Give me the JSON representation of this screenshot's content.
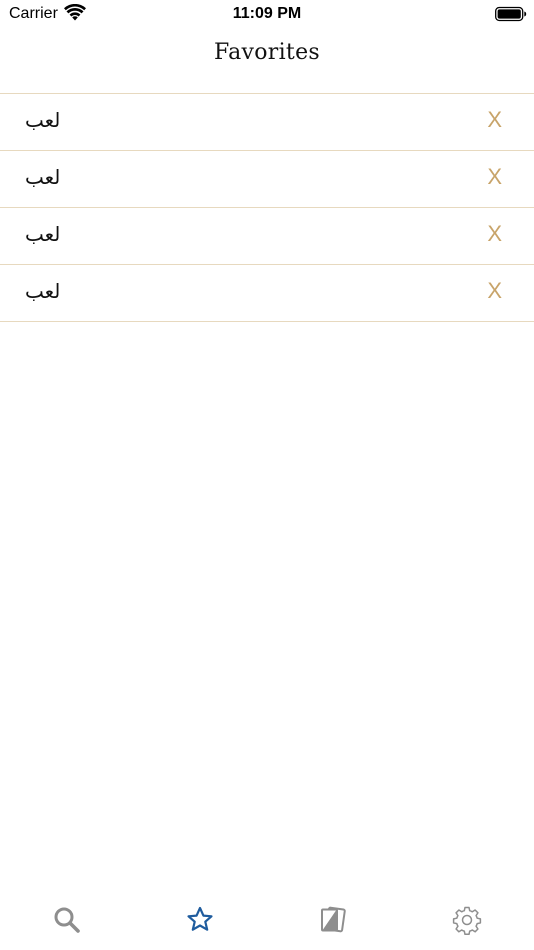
{
  "status_bar": {
    "carrier": "Carrier",
    "time": "11:09 PM"
  },
  "nav": {
    "title": "Favorites"
  },
  "favorites": [
    {
      "word": "لعب",
      "remove_label": "X"
    },
    {
      "word": "لعب",
      "remove_label": "X"
    },
    {
      "word": "لعب",
      "remove_label": "X"
    },
    {
      "word": "لعب",
      "remove_label": "X"
    }
  ],
  "tab_bar": {
    "tabs": [
      {
        "icon": "search-icon",
        "selected": false
      },
      {
        "icon": "star-icon",
        "selected": true
      },
      {
        "icon": "cards-icon",
        "selected": false
      },
      {
        "icon": "gear-icon",
        "selected": false
      }
    ]
  },
  "colors": {
    "accent_gold": "#c8a46a",
    "separator": "#e7d9bf",
    "tab_selected": "#1f5c9e",
    "tab_inactive": "#8e8e8e"
  }
}
